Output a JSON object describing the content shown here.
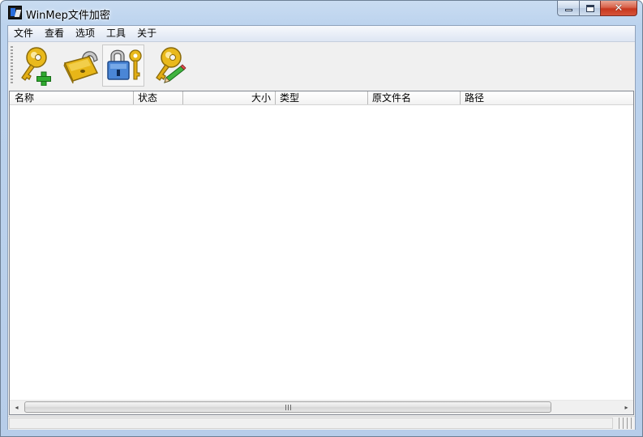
{
  "window": {
    "title": "WinMep文件加密",
    "app_icon": "winmep-app-icon",
    "caption_buttons": [
      "minimize-icon",
      "maximize-icon",
      "close-icon"
    ]
  },
  "menubar": {
    "items": [
      {
        "label": "文件"
      },
      {
        "label": "查看"
      },
      {
        "label": "选项"
      },
      {
        "label": "工具"
      },
      {
        "label": "关于"
      }
    ]
  },
  "toolbar": {
    "buttons": [
      {
        "icon": "key-add-icon",
        "pressed": false
      },
      {
        "icon": "padlock-icon",
        "pressed": false
      },
      {
        "icon": "lock-key-icon",
        "pressed": true
      },
      {
        "icon": "key-edit-icon",
        "pressed": false
      }
    ]
  },
  "listview": {
    "columns": [
      {
        "label": "名称"
      },
      {
        "label": "状态"
      },
      {
        "label": "大小"
      },
      {
        "label": "类型"
      },
      {
        "label": "原文件名"
      },
      {
        "label": "路径"
      }
    ],
    "rows": []
  },
  "scrollbar": {
    "left_arrow": "◂",
    "right_arrow": "▸"
  },
  "status": {
    "text": ""
  },
  "colors": {
    "frame": "#b9cfe9",
    "close_button": "#c7371e",
    "key_gold": "#e7b618",
    "plus_green": "#2faa2f"
  }
}
